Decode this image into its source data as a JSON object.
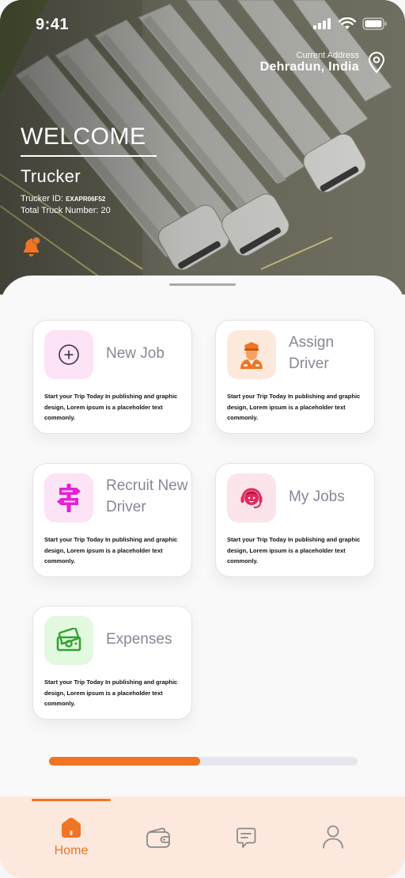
{
  "status_bar": {
    "time": "9:41"
  },
  "header": {
    "address_caption": "Current Address",
    "address_value": "Dehradun, India",
    "welcome_title": "WELCOME",
    "user_name": "Trucker",
    "trucker_id_label": "Trucker ID:",
    "trucker_id_value": "EXAPR06F52",
    "truck_count_text": "Total Truck Number: 20"
  },
  "cards": [
    {
      "title": "New Job",
      "icon": "plus-circle-icon",
      "icon_bg": "#fde3f6",
      "description": "Start your Trip Today In publishing and graphic design, Lorem ipsum is a placeholder text commonly."
    },
    {
      "title": "Assign Driver",
      "icon": "driver-icon",
      "icon_bg": "#fde9dc",
      "description": "Start your Trip Today In publishing and graphic design, Lorem ipsum is a placeholder text commonly."
    },
    {
      "title": "Recruit New Driver",
      "icon": "signpost-icon",
      "icon_bg": "#fde3f6",
      "description": "Start your Trip Today In publishing and graphic design, Lorem ipsum is a placeholder text commonly."
    },
    {
      "title": "My Jobs",
      "icon": "support-agent-icon",
      "icon_bg": "#fbe4ea",
      "description": "Start your Trip Today In publishing and graphic design, Lorem ipsum is a placeholder text commonly."
    },
    {
      "title": "Expenses",
      "icon": "cash-icon",
      "icon_bg": "#e3f9e0",
      "description": "Start your Trip Today In publishing and graphic design, Lorem ipsum is a placeholder text commonly."
    }
  ],
  "progress": {
    "fraction": 0.49
  },
  "nav": {
    "active": "home",
    "items": [
      {
        "id": "home",
        "label": "Home",
        "icon": "home-icon"
      },
      {
        "id": "wallet",
        "label": "",
        "icon": "wallet-icon"
      },
      {
        "id": "messages",
        "label": "",
        "icon": "chat-icon"
      },
      {
        "id": "profile",
        "label": "",
        "icon": "user-icon"
      }
    ]
  },
  "colors": {
    "accent": "#f07422",
    "card_title": "#8a8694",
    "nav_bg": "#fde8de"
  }
}
